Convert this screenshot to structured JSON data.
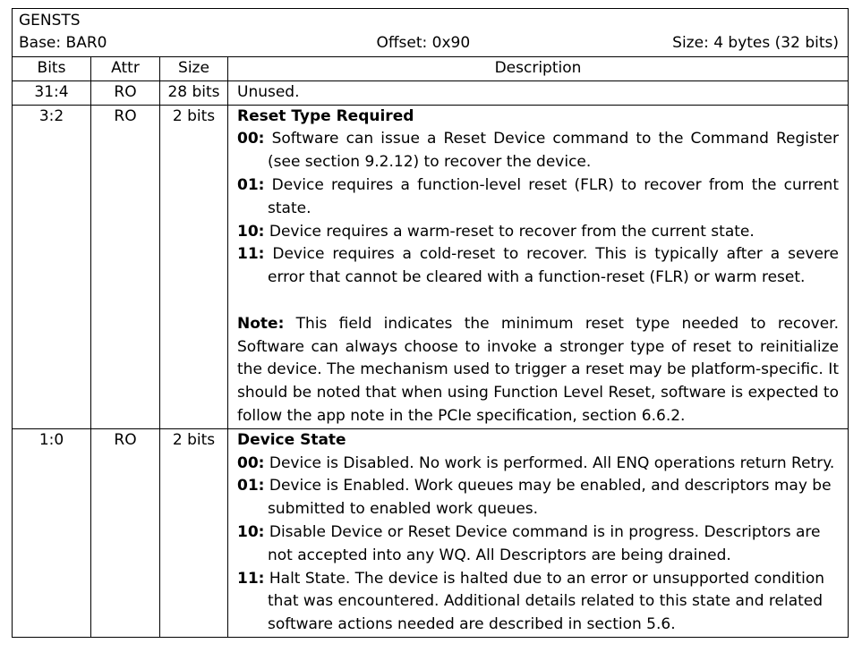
{
  "header": {
    "register": "GENSTS",
    "base": "Base: BAR0",
    "offset": "Offset: 0x90",
    "size": "Size: 4 bytes (32 bits)"
  },
  "columns": {
    "bits": "Bits",
    "attr": "Attr",
    "size": "Size",
    "description": "Description"
  },
  "rows": [
    {
      "bits": "31:4",
      "attr": "RO",
      "size": "28 bits",
      "text": "Unused."
    },
    {
      "bits": "3:2",
      "attr": "RO",
      "size": "2 bits",
      "title": "Reset Type Required",
      "entries": [
        {
          "code": "00:",
          "text": " Software can issue a Reset Device command to the Command Register (see section 9.2.12) to recover the device."
        },
        {
          "code": "01:",
          "text": " Device requires a function-level reset (FLR) to recover from the current state."
        },
        {
          "code": "10:",
          "text": " Device requires a warm-reset to recover from the current state."
        },
        {
          "code": "11:",
          "text": " Device requires a cold-reset to recover. This is typically after a severe error that cannot be cleared with a function-reset (FLR) or warm reset."
        }
      ],
      "note_label": "Note:",
      "note_text": " This field indicates the minimum reset type needed to recover. Software can always choose to invoke a stronger type of reset to reinitialize the device. The mechanism used to trigger a reset may be platform-specific. It should be noted that when using Function Level Reset, software is expected to follow the app note in the PCIe specification, section 6.6.2."
    },
    {
      "bits": "1:0",
      "attr": "RO",
      "size": "2 bits",
      "title": "Device State",
      "entries": [
        {
          "code": "00:",
          "text": " Device is Disabled. No work is performed. All ENQ operations return Retry."
        },
        {
          "code": "01:",
          "text": " Device is Enabled. Work queues may be enabled, and descriptors may be submitted to enabled work queues."
        },
        {
          "code": "10:",
          "text": " Disable Device or Reset Device command is in progress. Descriptors are not accepted into any WQ. All Descriptors are being drained."
        },
        {
          "code": "11:",
          "text": " Halt State. The device is halted due to an error or unsupported condition that was encountered. Additional details related to this state and related software actions needed are described in section 5.6."
        }
      ]
    }
  ]
}
